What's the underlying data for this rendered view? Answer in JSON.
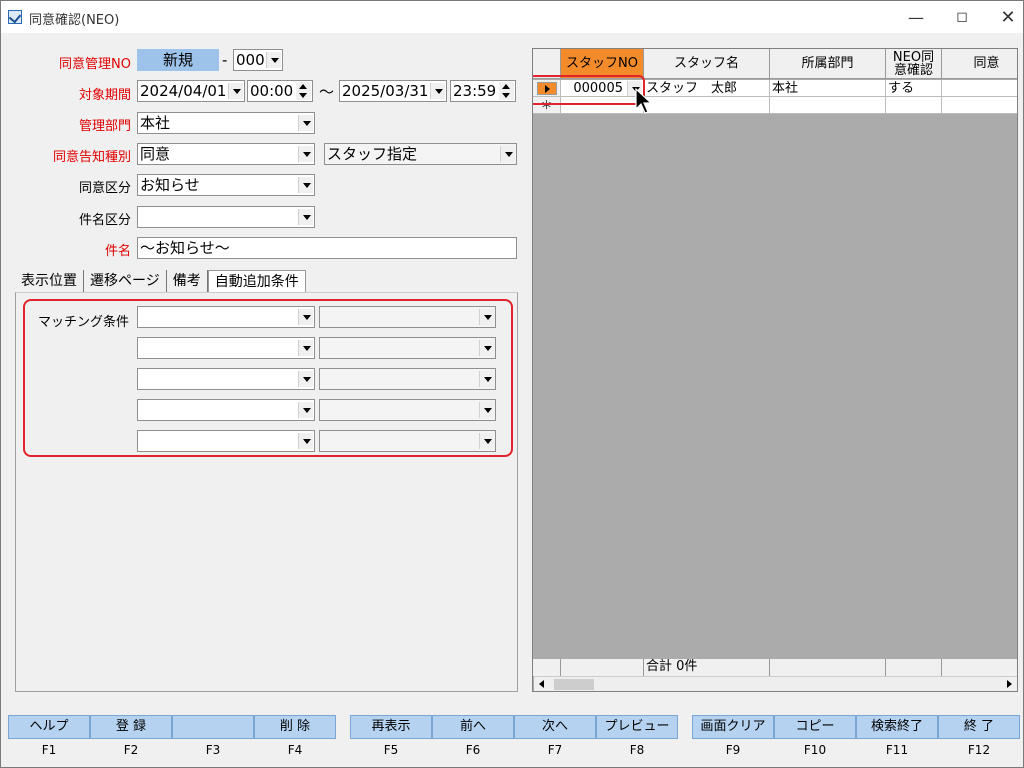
{
  "window": {
    "title": "同意確認(NEO)",
    "minimize_icon": "minimize-icon",
    "maximize_icon": "maximize-icon",
    "close_icon": "close-icon"
  },
  "form": {
    "agreement_no_label": "同意管理NO",
    "agreement_no_value": "新規",
    "agreement_no_dash": "-",
    "agreement_no_suffix": "000",
    "period_label": "対象期間",
    "period_start_date": "2024/04/01",
    "period_start_time": "00:00",
    "period_sep": "～",
    "period_end_date": "2025/03/31",
    "period_end_time": "23:59",
    "dept_label": "管理部門",
    "dept_value": "本社",
    "notice_type_label": "同意告知種別",
    "notice_type_value": "同意",
    "staff_spec_value": "スタッフ指定",
    "category_label": "同意区分",
    "category_value": "お知らせ",
    "subject_type_label": "件名区分",
    "subject_type_value": "",
    "subject_label": "件名",
    "subject_value": "～お知らせ～"
  },
  "tabs": [
    "表示位置",
    "遷移ページ",
    "備考",
    "自動追加条件"
  ],
  "matching": {
    "label": "マッチング条件",
    "rows": 5
  },
  "grid": {
    "headers": [
      "スタッフNO",
      "スタッフ名",
      "所属部門",
      "NEO同\n意確認",
      "同意"
    ],
    "header_neo_line1": "NEO同",
    "header_neo_line2": "意確認",
    "rows": [
      {
        "staff_no": "000005",
        "staff_name": "スタッフ　太郎",
        "dept": "本社",
        "neo": "する"
      }
    ],
    "new_row_marker": "＊",
    "footer_total": "合計 0件"
  },
  "fkeys": [
    {
      "label": "ヘルプ",
      "key": "F1"
    },
    {
      "label": "登 録",
      "key": "F2"
    },
    {
      "label": "",
      "key": "F3"
    },
    {
      "label": "削 除",
      "key": "F4"
    },
    {
      "label": "再表示",
      "key": "F5"
    },
    {
      "label": "前へ",
      "key": "F6"
    },
    {
      "label": "次へ",
      "key": "F7"
    },
    {
      "label": "プレビュー",
      "key": "F8"
    },
    {
      "label": "画面クリア",
      "key": "F9"
    },
    {
      "label": "コピー",
      "key": "F10"
    },
    {
      "label": "検索終了",
      "key": "F11"
    },
    {
      "label": "終 了",
      "key": "F12"
    }
  ]
}
